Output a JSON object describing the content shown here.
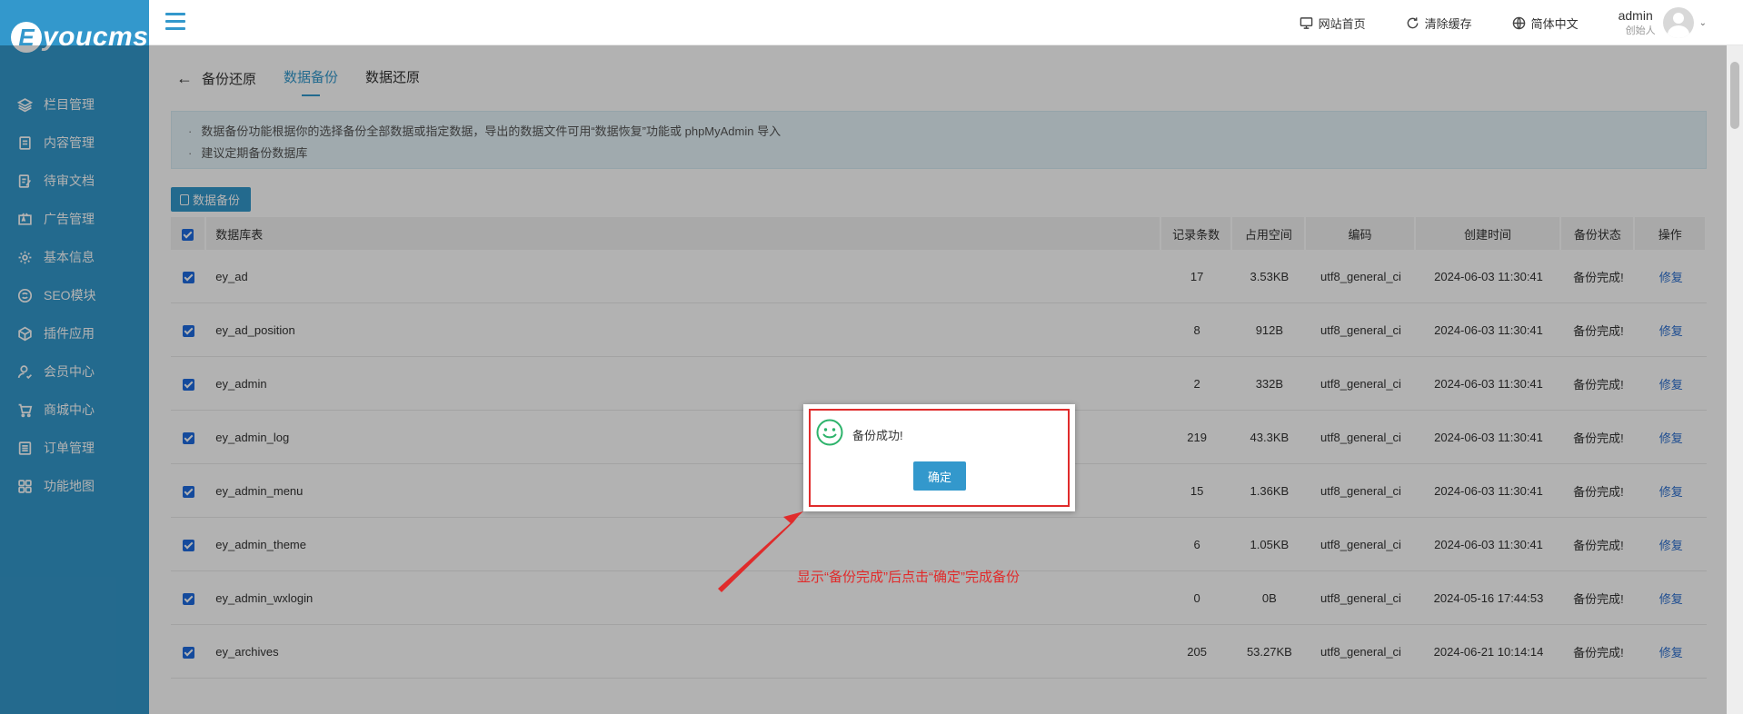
{
  "brand": {
    "badge": "E",
    "name": "youcms"
  },
  "sidebar": {
    "items": [
      {
        "label": "栏目管理",
        "icon": "layers-icon"
      },
      {
        "label": "内容管理",
        "icon": "document-icon"
      },
      {
        "label": "待审文档",
        "icon": "edit-doc-icon"
      },
      {
        "label": "广告管理",
        "icon": "ad-icon"
      },
      {
        "label": "基本信息",
        "icon": "gear-icon"
      },
      {
        "label": "SEO模块",
        "icon": "seo-icon"
      },
      {
        "label": "插件应用",
        "icon": "cube-icon"
      },
      {
        "label": "会员中心",
        "icon": "user-icon"
      },
      {
        "label": "商城中心",
        "icon": "cart-icon"
      },
      {
        "label": "订单管理",
        "icon": "list-icon"
      },
      {
        "label": "功能地图",
        "icon": "grid-icon"
      }
    ]
  },
  "topbar": {
    "links": [
      {
        "label": "网站首页",
        "icon": "monitor-icon"
      },
      {
        "label": "清除缓存",
        "icon": "refresh-icon"
      },
      {
        "label": "简体中文",
        "icon": "globe-icon"
      }
    ],
    "user": {
      "name": "admin",
      "role": "创始人"
    }
  },
  "page": {
    "back_label": "备份还原",
    "tabs": [
      "数据备份",
      "数据还原"
    ],
    "tips": [
      "数据备份功能根据你的选择备份全部数据或指定数据，导出的数据文件可用“数据恢复”功能或 phpMyAdmin 导入",
      "建议定期备份数据库"
    ],
    "backup_button": "数据备份"
  },
  "table": {
    "headers": [
      "数据库表",
      "记录条数",
      "占用空间",
      "编码",
      "创建时间",
      "备份状态",
      "操作"
    ],
    "rows": [
      {
        "name": "ey_ad",
        "records": "17",
        "size": "3.53KB",
        "encoding": "utf8_general_ci",
        "created": "2024-06-03 11:30:41",
        "status": "备份完成!",
        "action": "修复"
      },
      {
        "name": "ey_ad_position",
        "records": "8",
        "size": "912B",
        "encoding": "utf8_general_ci",
        "created": "2024-06-03 11:30:41",
        "status": "备份完成!",
        "action": "修复"
      },
      {
        "name": "ey_admin",
        "records": "2",
        "size": "332B",
        "encoding": "utf8_general_ci",
        "created": "2024-06-03 11:30:41",
        "status": "备份完成!",
        "action": "修复"
      },
      {
        "name": "ey_admin_log",
        "records": "219",
        "size": "43.3KB",
        "encoding": "utf8_general_ci",
        "created": "2024-06-03 11:30:41",
        "status": "备份完成!",
        "action": "修复"
      },
      {
        "name": "ey_admin_menu",
        "records": "15",
        "size": "1.36KB",
        "encoding": "utf8_general_ci",
        "created": "2024-06-03 11:30:41",
        "status": "备份完成!",
        "action": "修复"
      },
      {
        "name": "ey_admin_theme",
        "records": "6",
        "size": "1.05KB",
        "encoding": "utf8_general_ci",
        "created": "2024-06-03 11:30:41",
        "status": "备份完成!",
        "action": "修复"
      },
      {
        "name": "ey_admin_wxlogin",
        "records": "0",
        "size": "0B",
        "encoding": "utf8_general_ci",
        "created": "2024-05-16 17:44:53",
        "status": "备份完成!",
        "action": "修复"
      },
      {
        "name": "ey_archives",
        "records": "205",
        "size": "53.27KB",
        "encoding": "utf8_general_ci",
        "created": "2024-06-21 10:14:14",
        "status": "备份完成!",
        "action": "修复"
      }
    ]
  },
  "dialog": {
    "message": "备份成功!",
    "ok_label": "确定"
  },
  "annotation": "显示“备份完成”后点击“确定”完成备份",
  "colors": {
    "brand": "#3398cc",
    "highlight": "#e02b2b",
    "checkbox": "#1d6be0"
  }
}
